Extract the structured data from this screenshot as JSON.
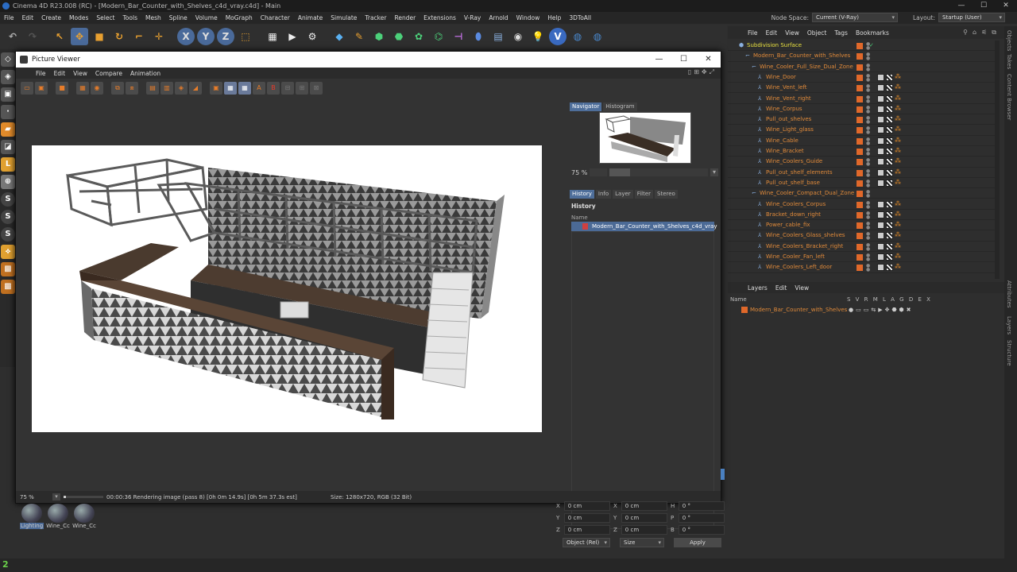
{
  "app": {
    "title": "Cinema 4D R23.008 (RC) - [Modern_Bar_Counter_with_Shelves_c4d_vray.c4d] - Main"
  },
  "menubar": [
    "File",
    "Edit",
    "Create",
    "Modes",
    "Select",
    "Tools",
    "Mesh",
    "Spline",
    "Volume",
    "MoGraph",
    "Character",
    "Animate",
    "Simulate",
    "Tracker",
    "Render",
    "Extensions",
    "V-Ray",
    "Arnold",
    "Window",
    "Help",
    "3DToAll"
  ],
  "nodespace": {
    "label": "Node Space:",
    "value": "Current (V-Ray)"
  },
  "layout": {
    "label": "Layout:",
    "value": "Startup (User)"
  },
  "toolbar_axes": [
    "X",
    "Y",
    "Z"
  ],
  "picture_viewer": {
    "title": "Picture Viewer",
    "menu": [
      "File",
      "Edit",
      "View",
      "Compare",
      "Animation"
    ],
    "nav_tabs": [
      "Navigator",
      "Histogram"
    ],
    "zoom": "75 %",
    "info_tabs": [
      "History",
      "Info",
      "Layer",
      "Filter",
      "Stereo"
    ],
    "history_title": "History",
    "history_col": "Name",
    "history_item": "Modern_Bar_Counter_with_Shelves_c4d_vray",
    "status_zoom": "75 %",
    "status_text": "00:00:36 Rendering image (pass 8) [0h  0m 14.9s] [0h  5m 37.3s est]",
    "status_size": "Size: 1280x720, RGB (32 Bit)"
  },
  "objects_menu": [
    "File",
    "Edit",
    "View",
    "Object",
    "Tags",
    "Bookmarks"
  ],
  "objects": [
    {
      "name": "Subdivision Surface",
      "indent": 0,
      "color": "#e8e040"
    },
    {
      "name": "Modern_Bar_Counter_with_Shelves",
      "indent": 1,
      "color": "#e08a3a"
    },
    {
      "name": "Wine_Cooler_Full_Size_Dual_Zone",
      "indent": 2,
      "color": "#e08a3a"
    },
    {
      "name": "Wine_Door",
      "indent": 3,
      "color": "#e08a3a"
    },
    {
      "name": "Wine_Vent_left",
      "indent": 3,
      "color": "#e08a3a"
    },
    {
      "name": "Wine_Vent_right",
      "indent": 3,
      "color": "#e08a3a"
    },
    {
      "name": "Wine_Corpus",
      "indent": 3,
      "color": "#e08a3a"
    },
    {
      "name": "Pull_out_shelves",
      "indent": 3,
      "color": "#e08a3a"
    },
    {
      "name": "Wine_Light_glass",
      "indent": 3,
      "color": "#e08a3a"
    },
    {
      "name": "Wine_Cable",
      "indent": 3,
      "color": "#e08a3a"
    },
    {
      "name": "Wine_Bracket",
      "indent": 3,
      "color": "#e08a3a"
    },
    {
      "name": "Wine_Coolers_Guide",
      "indent": 3,
      "color": "#e08a3a"
    },
    {
      "name": "Pull_out_shelf_elements",
      "indent": 3,
      "color": "#e08a3a"
    },
    {
      "name": "Pull_out_shelf_base",
      "indent": 3,
      "color": "#e08a3a"
    },
    {
      "name": "Wine_Cooler_Compact_Dual_Zone",
      "indent": 2,
      "color": "#e08a3a"
    },
    {
      "name": "Wine_Coolers_Corpus",
      "indent": 3,
      "color": "#e08a3a"
    },
    {
      "name": "Bracket_down_right",
      "indent": 3,
      "color": "#e08a3a"
    },
    {
      "name": "Power_cable_fix",
      "indent": 3,
      "color": "#e08a3a"
    },
    {
      "name": "Wine_Coolers_Glass_shelves",
      "indent": 3,
      "color": "#e08a3a"
    },
    {
      "name": "Wine_Coolers_Bracket_right",
      "indent": 3,
      "color": "#e08a3a"
    },
    {
      "name": "Wine_Cooler_Fan_left",
      "indent": 3,
      "color": "#e08a3a"
    },
    {
      "name": "Wine_Coolers_Left_door",
      "indent": 3,
      "color": "#e08a3a"
    }
  ],
  "layers_menu": [
    "Layers",
    "Edit",
    "View"
  ],
  "layers_header": {
    "name": "Name",
    "flags": "S V R M L A G D E X"
  },
  "layer_item": "Modern_Bar_Counter_with_Shelves",
  "side_tabs": [
    "Objects",
    "Takes",
    "Content Browser",
    "Attributes",
    "Layers",
    "Structure"
  ],
  "coords": {
    "rows": [
      {
        "a": "X",
        "v1": "0 cm",
        "b": "X",
        "v2": "0 cm",
        "c": "H",
        "v3": "0 °"
      },
      {
        "a": "Y",
        "v1": "0 cm",
        "b": "Y",
        "v2": "0 cm",
        "c": "P",
        "v3": "0 °"
      },
      {
        "a": "Z",
        "v1": "0 cm",
        "b": "Z",
        "v2": "0 cm",
        "c": "B",
        "v3": "0 °"
      }
    ],
    "mode": "Object (Rel)",
    "size": "Size",
    "apply": "Apply"
  },
  "materials": [
    "Lighting",
    "Wine_Cc",
    "Wine_Cc"
  ]
}
